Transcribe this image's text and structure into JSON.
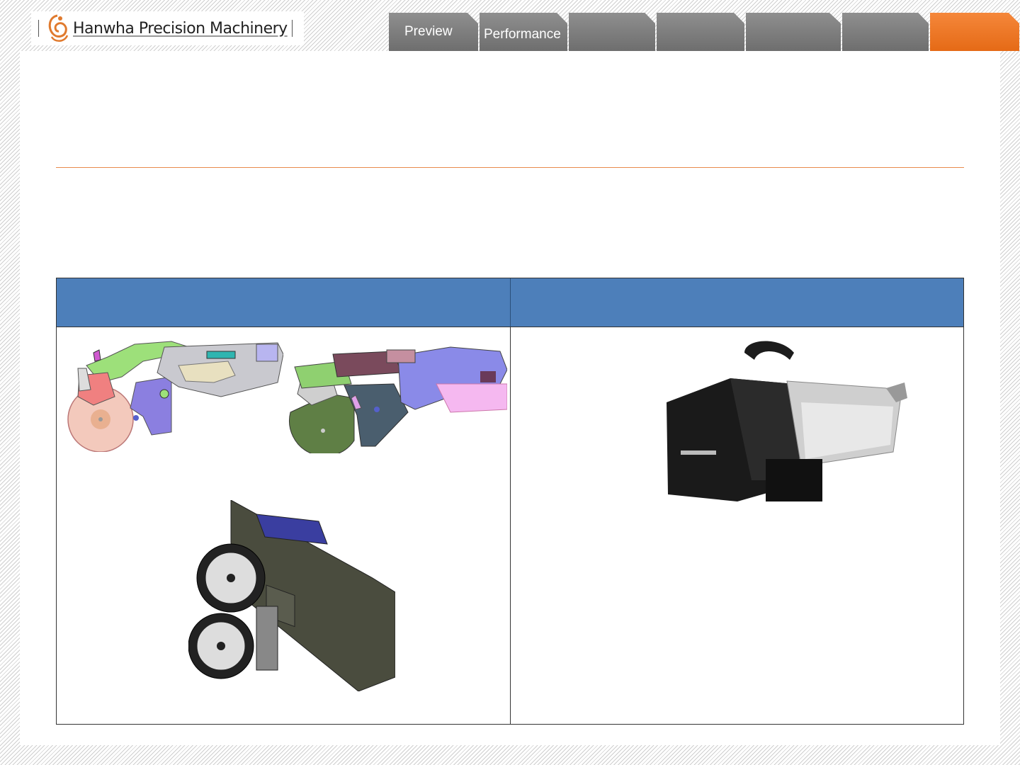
{
  "brand": {
    "name": "Hanwha Precision Machinery"
  },
  "nav": {
    "tabs": [
      {
        "label": "Preview"
      },
      {
        "label": "Performance"
      },
      {
        "label": ""
      },
      {
        "label": ""
      },
      {
        "label": ""
      },
      {
        "label": ""
      },
      {
        "label": ""
      }
    ],
    "active_color": "#E96E1E",
    "tab_color": "#7F7F7F"
  },
  "table": {
    "header_color": "#4F81BD",
    "columns": [
      {
        "header": ""
      },
      {
        "header": ""
      }
    ]
  },
  "figures": {
    "left_top_a": "feeder-section-drawing-icon",
    "left_top_b": "feeder-section-drawing-icon",
    "left_bottom": "feeder-3d-render-icon",
    "right": "feeder-photo-icon"
  }
}
